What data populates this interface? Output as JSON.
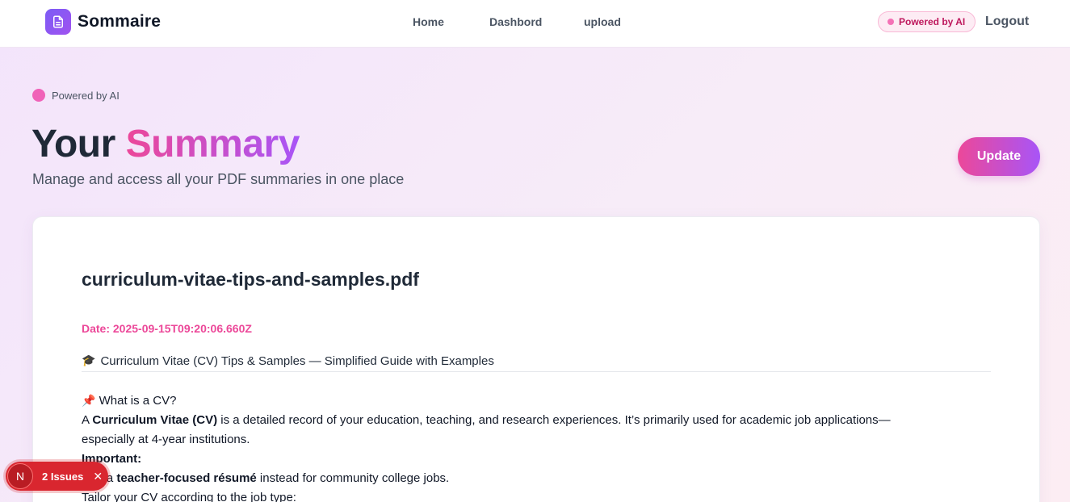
{
  "header": {
    "brand": "Sommaire",
    "nav": [
      "Home",
      "Dashbord",
      "upload"
    ],
    "badge": "Powered by AI",
    "logout": "Logout"
  },
  "hero": {
    "badge": "Powered by AI",
    "title_plain": "Your",
    "title_accent": "Summary",
    "subtitle": "Manage and access all your PDF summaries in one place",
    "update_label": "Update"
  },
  "summary": {
    "file_name": "curriculum-vitae-tips-and-samples.pdf",
    "date": "Date: 2025-09-15T09:20:06.660Z",
    "heading_icon": "🎓",
    "heading": "Curriculum Vitae (CV) Tips & Samples — Simplified Guide with Examples",
    "section_icon": "📌",
    "section_title": "What is a CV?",
    "p1_prefix": "A ",
    "p1_bold": "Curriculum Vitae (CV)",
    "p1_rest": " is a detailed record of your education, teaching, and research experiences. It’s primarily used for academic job applications—",
    "p1_line2": "especially at 4-year institutions.",
    "important": "Important:",
    "p2_prefix": "Use a ",
    "p2_bold": "teacher-focused résumé",
    "p2_rest": " instead for community college jobs.",
    "p3": "Tailor your CV according to the job type:"
  },
  "devtools": {
    "n_label": "N",
    "issues_label": "2 Issues",
    "close_label": "✕"
  },
  "colors": {
    "accent_pink": "#ec4899",
    "accent_purple": "#a855f7",
    "issues_red": "#d9262f"
  },
  "icons": [
    "document-icon",
    "graduation-cap-icon",
    "pushpin-icon",
    "close-icon"
  ]
}
